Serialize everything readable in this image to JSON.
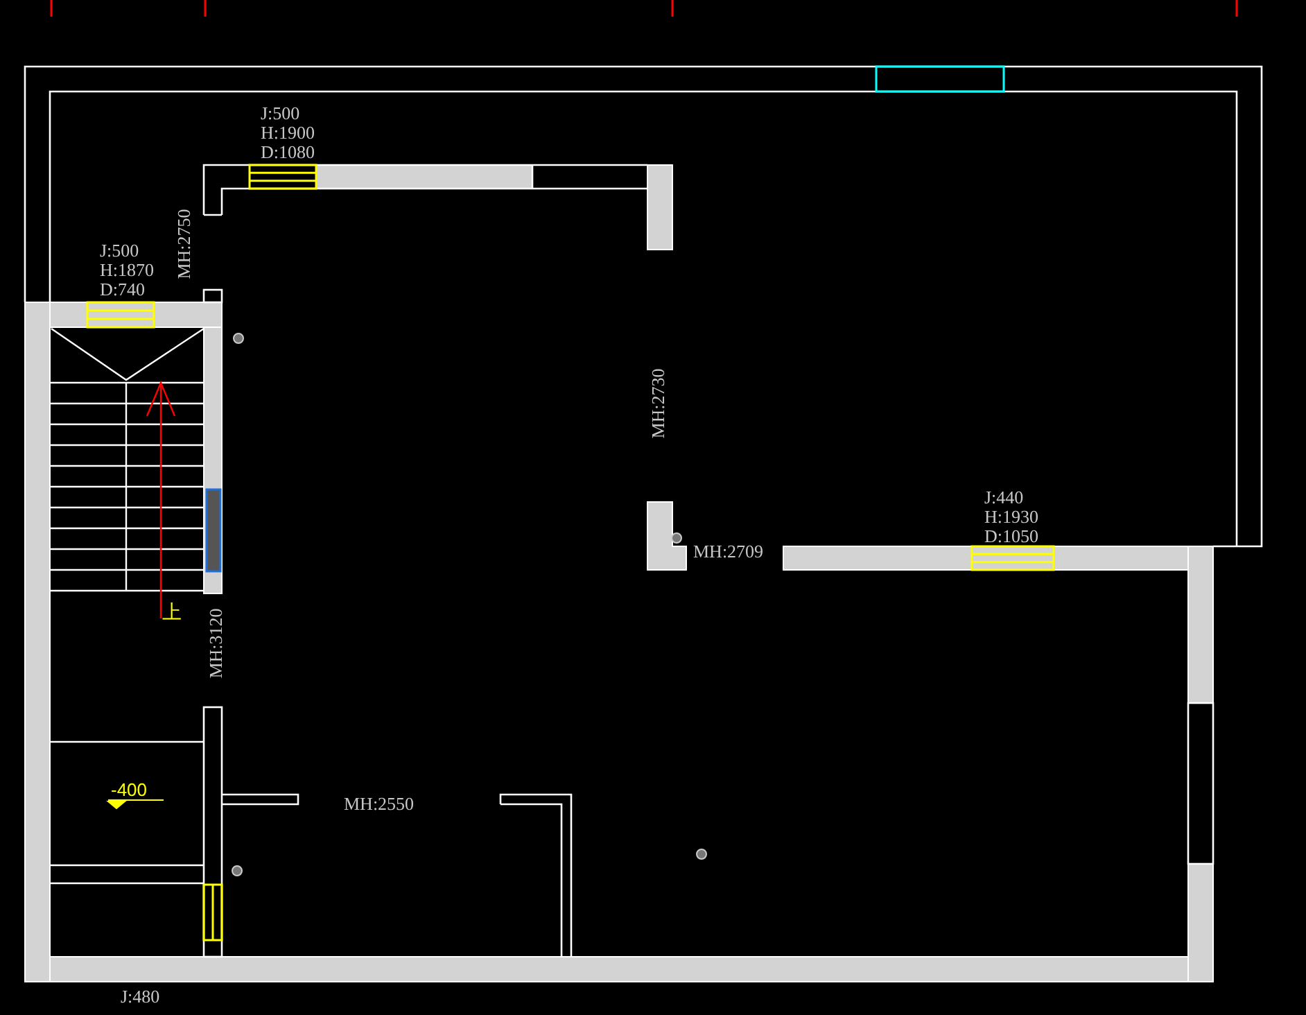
{
  "window_tags": [
    {
      "lines": [
        "J:500",
        "H:1900",
        "D:1080"
      ]
    },
    {
      "lines": [
        "J:500",
        "H:1870",
        "D:740"
      ]
    },
    {
      "lines": [
        "J:440",
        "H:1930",
        "D:1050"
      ]
    },
    {
      "lines": [
        "J:480"
      ]
    }
  ],
  "ceiling_heights": [
    {
      "text": "MH:2750",
      "vertical": true
    },
    {
      "text": "MH:2730",
      "vertical": true
    },
    {
      "text": "MH:2709",
      "vertical": false
    },
    {
      "text": "MH:3120",
      "vertical": true
    },
    {
      "text": "MH:2550",
      "vertical": false
    }
  ],
  "level_mark": {
    "text": "-400"
  },
  "stair": {
    "label": "上"
  }
}
